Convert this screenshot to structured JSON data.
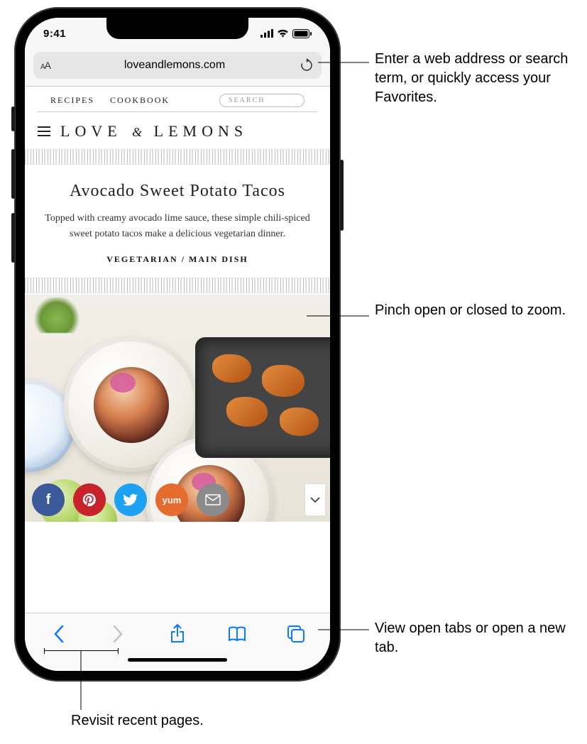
{
  "status": {
    "time": "9:41"
  },
  "urlbar": {
    "domain": "loveandlemons.com"
  },
  "sitenav": {
    "recipes": "RECIPES",
    "cookbook": "COOKBOOK",
    "search_placeholder": "SEARCH"
  },
  "brand": {
    "part1": "LOVE",
    "amp": "&",
    "part2": "LEMONS"
  },
  "recipe": {
    "title": "Avocado Sweet Potato Tacos",
    "desc": "Topped with creamy avocado lime sauce, these simple chili-spiced sweet potato tacos make a delicious vegetarian dinner.",
    "tags": "VEGETARIAN / MAIN DISH"
  },
  "social": {
    "yum_label": "yum"
  },
  "callouts": {
    "url": "Enter a web address or search term, or quickly access your Favorites.",
    "zoom": "Pinch open or closed to zoom.",
    "tabs": "View open tabs or open a new tab.",
    "back": "Revisit recent pages."
  }
}
